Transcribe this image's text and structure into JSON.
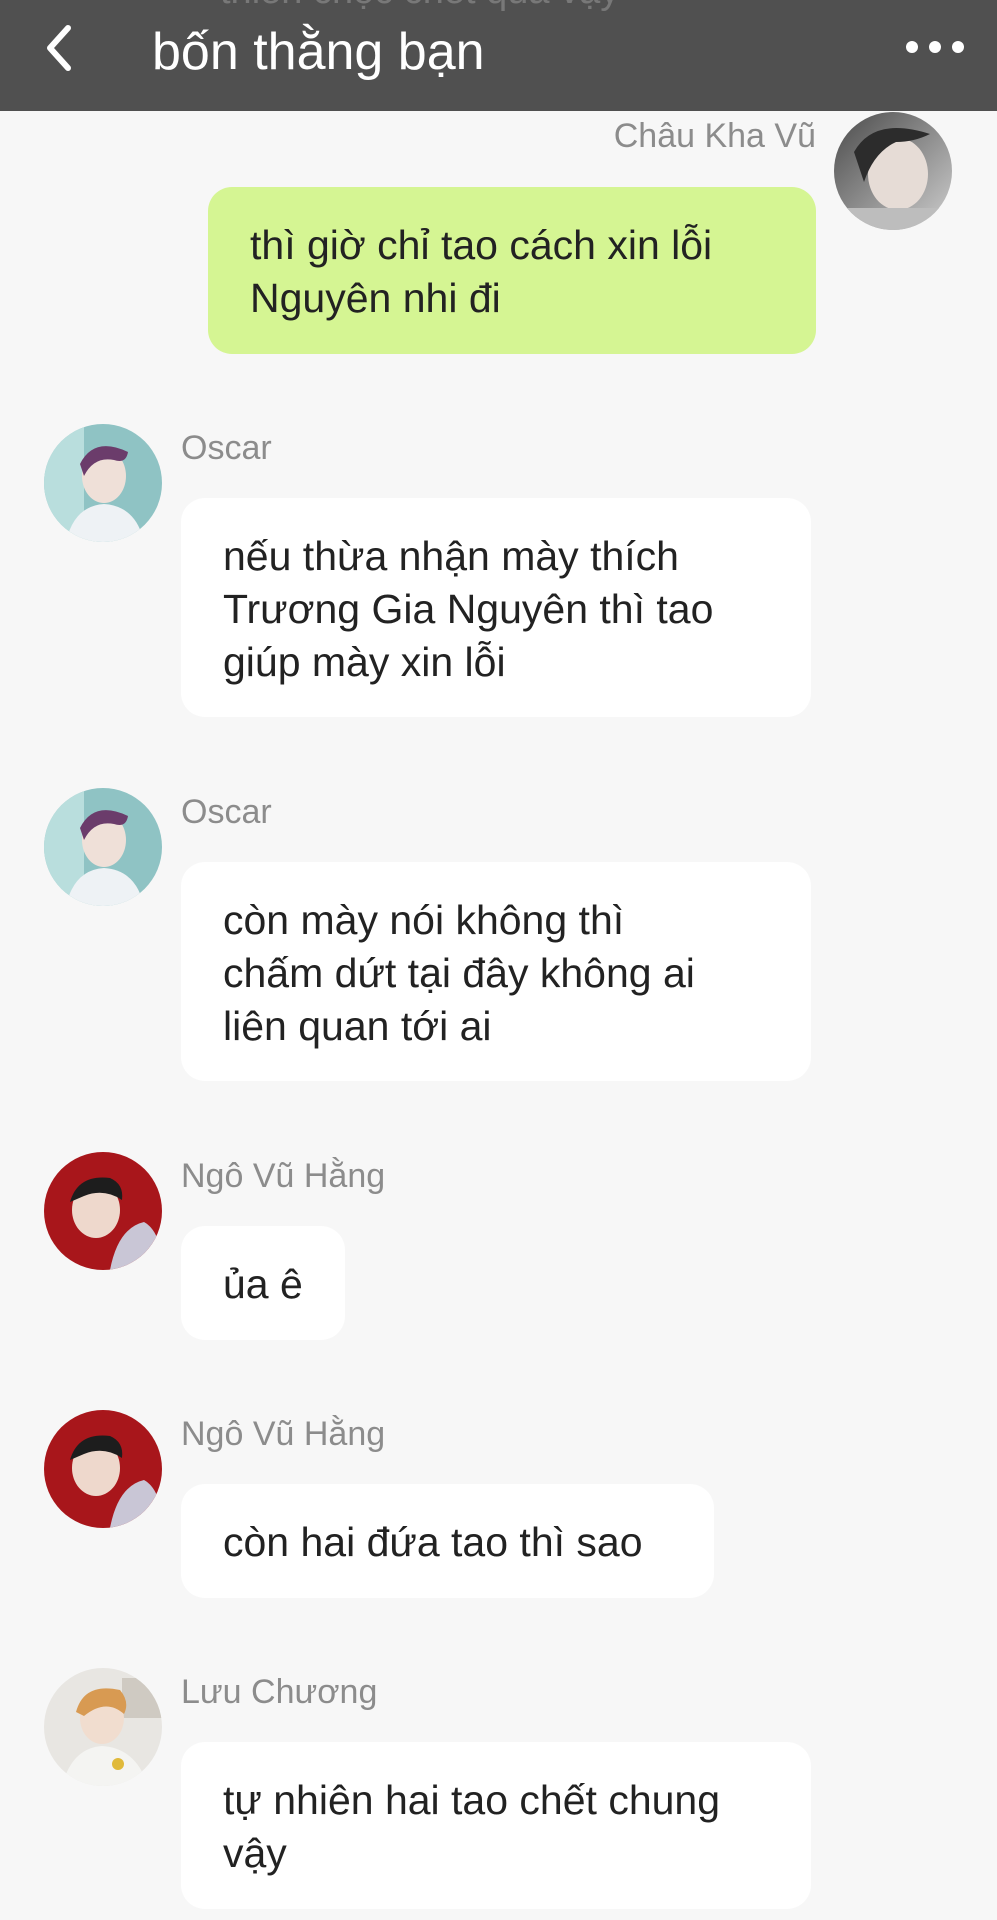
{
  "header": {
    "title": "bốn thằng bạn",
    "back_icon": "chevron-left-icon",
    "more_icon": "more-dots-icon",
    "peek_text": "thiên chọc chết quá vậy"
  },
  "colors": {
    "header_bg": "#505050",
    "chat_bg": "#f7f7f7",
    "own_bubble": "#d5f593",
    "other_bubble": "#ffffff",
    "name_text": "#8c8c8c"
  },
  "messages": [
    {
      "sender": "Châu Kha Vũ",
      "mine": true,
      "lines": [
        "thì giờ chỉ tao cách xin lỗi",
        "Nguyên nhi đi"
      ]
    },
    {
      "sender": "Oscar",
      "mine": false,
      "lines": [
        "nếu thừa nhận mày thích",
        "Trương Gia Nguyên thì tao",
        "giúp mày xin lỗi"
      ]
    },
    {
      "sender": "Oscar",
      "mine": false,
      "lines": [
        "còn mày nói không thì",
        "chấm dứt tại đây không ai",
        "liên quan tới ai"
      ]
    },
    {
      "sender": "Ngô Vũ Hằng",
      "mine": false,
      "lines": [
        "ủa ê"
      ]
    },
    {
      "sender": "Ngô Vũ Hằng",
      "mine": false,
      "lines": [
        "còn hai đứa tao thì sao"
      ]
    },
    {
      "sender": "Lưu Chương",
      "mine": false,
      "lines": [
        "tự nhiên hai tao chết chung",
        "vậy"
      ]
    }
  ]
}
